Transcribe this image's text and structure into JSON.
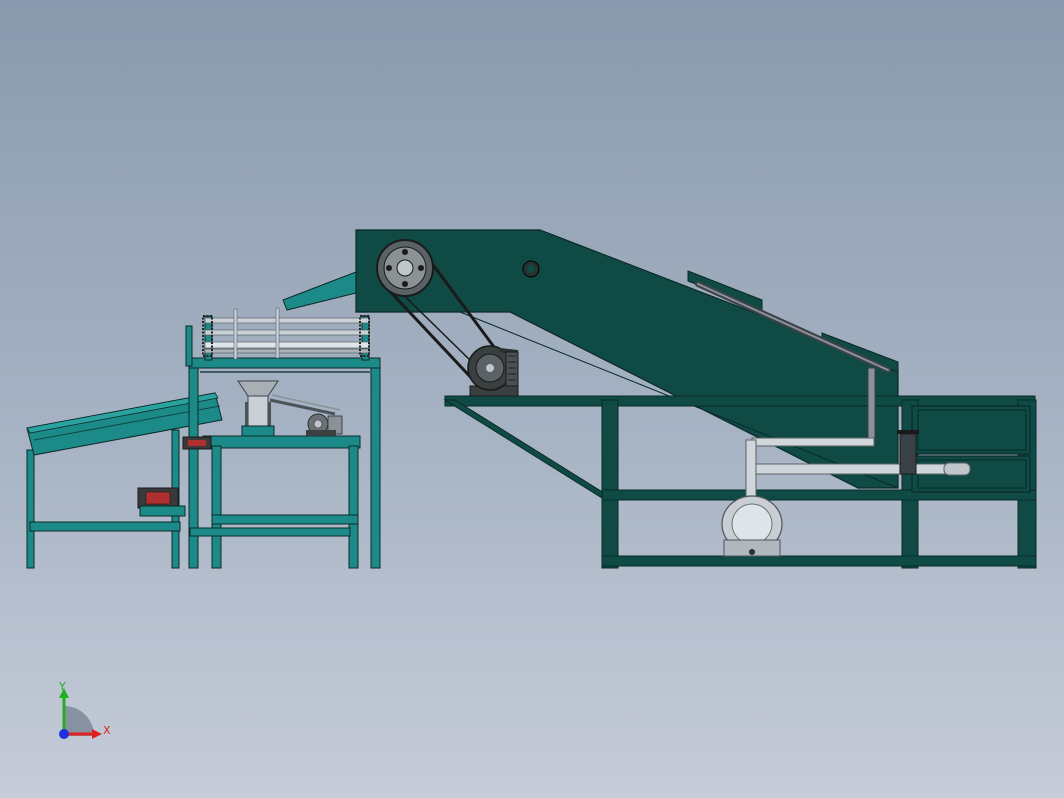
{
  "view": {
    "background_top": "#8a9aae",
    "background_bottom": "#c6ccd8"
  },
  "colors": {
    "frame_teal": "#1d8a8a",
    "body_dark_teal": "#0f4a44",
    "outline": "#0a2a28",
    "steel": "#9aa4aa",
    "steel_dark": "#4a5458",
    "motor_grey": "#3a3f40",
    "pipe": "#c8ced2"
  },
  "triad": {
    "x_label": "X",
    "y_label": "Y",
    "x_color": "#e02020",
    "y_color": "#20b020",
    "z_color": "#2030e0"
  }
}
